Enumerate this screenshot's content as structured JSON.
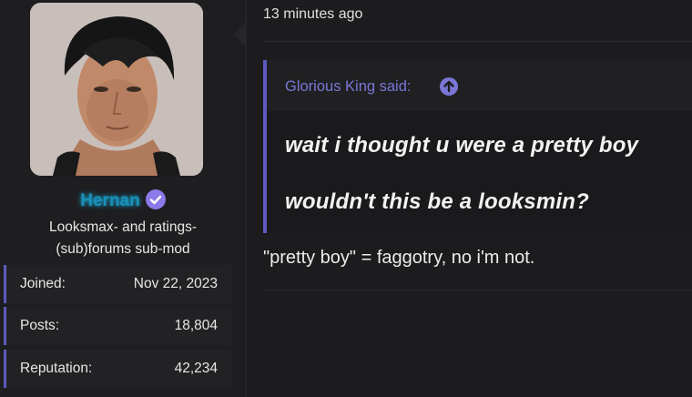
{
  "user": {
    "username": "Hernan",
    "title": "Looksmax- and ratings-(sub)forums sub-mod",
    "stats": [
      {
        "label": "Joined:",
        "value": "Nov 22, 2023"
      },
      {
        "label": "Posts:",
        "value": "18,804"
      },
      {
        "label": "Reputation:",
        "value": "42,234"
      }
    ],
    "verified_icon": "verified-check-icon",
    "colors": {
      "username": "#1b8fb6",
      "accent": "#5d5ac0"
    }
  },
  "post": {
    "timestamp": "13 minutes ago",
    "quote": {
      "author_label": "Glorious King said:",
      "jump_icon": "arrow-up-circle-icon",
      "lines": [
        "wait i thought u were a pretty boy",
        "wouldn't this be a looksmin?"
      ]
    },
    "reply": "\"pretty boy\" = faggotry, no i'm not."
  }
}
